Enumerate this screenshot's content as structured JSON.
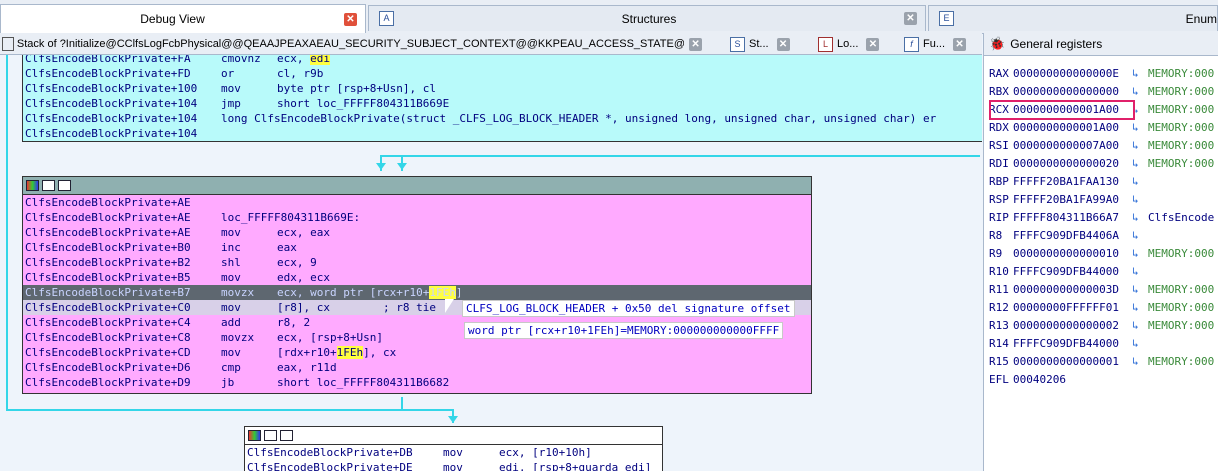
{
  "tabs": [
    {
      "label": "Debug View",
      "icon": "",
      "active": true
    },
    {
      "label": "Structures",
      "icon": "A",
      "active": false
    },
    {
      "label": "Enum",
      "icon": "E",
      "active": false
    }
  ],
  "subtabs": [
    {
      "label": "Stack of ?Initialize@CClfsLogFcbPhysical@@QEAAJPEAXAEAU_SECURITY_SUBJECT_CONTEXT@@KKPEAU_ACCESS_STATE@@DPEAU_C...",
      "icon": ""
    },
    {
      "label": "St...",
      "icon": "S"
    },
    {
      "label": "Lo...",
      "icon": "L"
    },
    {
      "label": "Fu...",
      "icon": "f"
    }
  ],
  "block1": {
    "lines": [
      {
        "addr": "ClfsEncodeBlockPrivate+FA",
        "op": "cmovnz",
        "args": "ecx, ",
        "hl": "edi",
        "rest": ""
      },
      {
        "addr": "ClfsEncodeBlockPrivate+FD",
        "op": "or",
        "args": "cl, r9b",
        "hl": "",
        "rest": ""
      },
      {
        "addr": "ClfsEncodeBlockPrivate+100",
        "op": "mov",
        "args": "byte ptr [rsp+8+Usn], cl",
        "hl": "",
        "rest": ""
      },
      {
        "addr": "ClfsEncodeBlockPrivate+104",
        "op": "jmp",
        "args": "short loc_FFFFF804311B669E",
        "hl": "",
        "rest": ""
      },
      {
        "addr": "ClfsEncodeBlockPrivate+104",
        "op": "long ClfsEncodeBlockPrivate(struct _CLFS_LOG_BLOCK_HEADER *, unsigned long, unsigned char, unsigned char) er",
        "args": "",
        "hl": "",
        "rest": ""
      },
      {
        "addr": "ClfsEncodeBlockPrivate+104",
        "op": "",
        "args": "",
        "hl": "",
        "rest": ""
      }
    ]
  },
  "block2": {
    "lines": [
      {
        "addr": "ClfsEncodeBlockPrivate+AE",
        "op": "",
        "args": "",
        "hl": "",
        "rest": ""
      },
      {
        "addr": "ClfsEncodeBlockPrivate+AE",
        "op": "loc_FFFFF804311B669E:",
        "args": "",
        "hl": "",
        "rest": ""
      },
      {
        "addr": "ClfsEncodeBlockPrivate+AE",
        "op": "mov",
        "args": "ecx, eax",
        "hl": "",
        "rest": ""
      },
      {
        "addr": "ClfsEncodeBlockPrivate+B0",
        "op": "inc",
        "args": "eax",
        "hl": "",
        "rest": ""
      },
      {
        "addr": "ClfsEncodeBlockPrivate+B2",
        "op": "shl",
        "args": "ecx, 9",
        "hl": "",
        "rest": ""
      },
      {
        "addr": "ClfsEncodeBlockPrivate+B5",
        "op": "mov",
        "args": "edx, ecx",
        "hl": "",
        "rest": ""
      },
      {
        "addr": "ClfsEncodeBlockPrivate+B7",
        "op": "movzx",
        "args": "ecx, word ptr [rcx+r10+",
        "hl": "1FEh",
        "rest": "]"
      },
      {
        "addr": "ClfsEncodeBlockPrivate+C0",
        "op": "mov",
        "args": "[r8], cx",
        "hl": "",
        "rest": "        ; r8 tie"
      },
      {
        "addr": "ClfsEncodeBlockPrivate+C4",
        "op": "add",
        "args": "r8, 2",
        "hl": "",
        "rest": ""
      },
      {
        "addr": "ClfsEncodeBlockPrivate+C8",
        "op": "movzx",
        "args": "ecx, [rsp+8+Usn]",
        "hl": "",
        "rest": ""
      },
      {
        "addr": "ClfsEncodeBlockPrivate+CD",
        "op": "mov",
        "args": "[rdx+r10+",
        "hl": "1FEh",
        "rest": "], cx"
      },
      {
        "addr": "ClfsEncodeBlockPrivate+D6",
        "op": "cmp",
        "args": "eax, r11d",
        "hl": "",
        "rest": ""
      },
      {
        "addr": "ClfsEncodeBlockPrivate+D9",
        "op": "jb",
        "args": "short loc_FFFFF804311B6682",
        "hl": "",
        "rest": ""
      }
    ]
  },
  "block3": {
    "lines": [
      {
        "addr": "ClfsEncodeBlockPrivate+DB",
        "op": "mov",
        "args": "ecx, [r10+10h]",
        "hl": "",
        "rest": ""
      },
      {
        "addr": "ClfsEncodeBlockPrivate+DE",
        "op": "mov",
        "args": "edi, [rsp+8+guarda_edi]",
        "hl": "",
        "rest": ""
      }
    ]
  },
  "tooltip_comment": "CLFS_LOG_BLOCK_HEADER + 0x50 del signature offset",
  "tooltip_hint": "word ptr [rcx+r10+1FEh]=MEMORY:000000000000FFFF",
  "registers": {
    "title": "General registers",
    "rows": [
      {
        "name": "RAX",
        "value": "000000000000000E",
        "arrow": "↳",
        "label": "MEMORY:000"
      },
      {
        "name": "RBX",
        "value": "0000000000000000",
        "arrow": "↳",
        "label": "MEMORY:000"
      },
      {
        "name": "RCX",
        "value": "0000000000001A00",
        "arrow": "↳",
        "label": "MEMORY:000"
      },
      {
        "name": "RDX",
        "value": "0000000000001A00",
        "arrow": "↳",
        "label": "MEMORY:000"
      },
      {
        "name": "RSI",
        "value": "0000000000007A00",
        "arrow": "↳",
        "label": "MEMORY:000"
      },
      {
        "name": "RDI",
        "value": "0000000000000020",
        "arrow": "↳",
        "label": "MEMORY:000"
      },
      {
        "name": "RBP",
        "value": "FFFFF20BA1FAA130",
        "arrow": "↳",
        "label": ""
      },
      {
        "name": "RSP",
        "value": "FFFFF20BA1FA99A0",
        "arrow": "↳",
        "label": ""
      },
      {
        "name": "RIP",
        "value": "FFFFF804311B66A7",
        "arrow": "↳",
        "label": "ClfsEncode"
      },
      {
        "name": "R8",
        "value": "FFFFC909DFB4406A",
        "arrow": "↳",
        "label": ""
      },
      {
        "name": "R9",
        "value": "0000000000000010",
        "arrow": "↳",
        "label": "MEMORY:000"
      },
      {
        "name": "R10",
        "value": "FFFFC909DFB44000",
        "arrow": "↳",
        "label": ""
      },
      {
        "name": "R11",
        "value": "000000000000003D",
        "arrow": "↳",
        "label": "MEMORY:000"
      },
      {
        "name": "R12",
        "value": "00000000FFFFFF01",
        "arrow": "↳",
        "label": "MEMORY:000"
      },
      {
        "name": "R13",
        "value": "0000000000000002",
        "arrow": "↳",
        "label": "MEMORY:000"
      },
      {
        "name": "R14",
        "value": "FFFFC909DFB44000",
        "arrow": "↳",
        "label": ""
      },
      {
        "name": "R15",
        "value": "0000000000000001",
        "arrow": "↳",
        "label": "MEMORY:000"
      },
      {
        "name": "EFL",
        "value": "00040206",
        "arrow": "",
        "label": ""
      }
    ]
  },
  "colors": {
    "block_cyan": "#b8fafa",
    "block_pink": "#ffaaff",
    "block_white": "#ffffff",
    "edge": "#33d6e8",
    "highlight_box": "#e0206a"
  }
}
